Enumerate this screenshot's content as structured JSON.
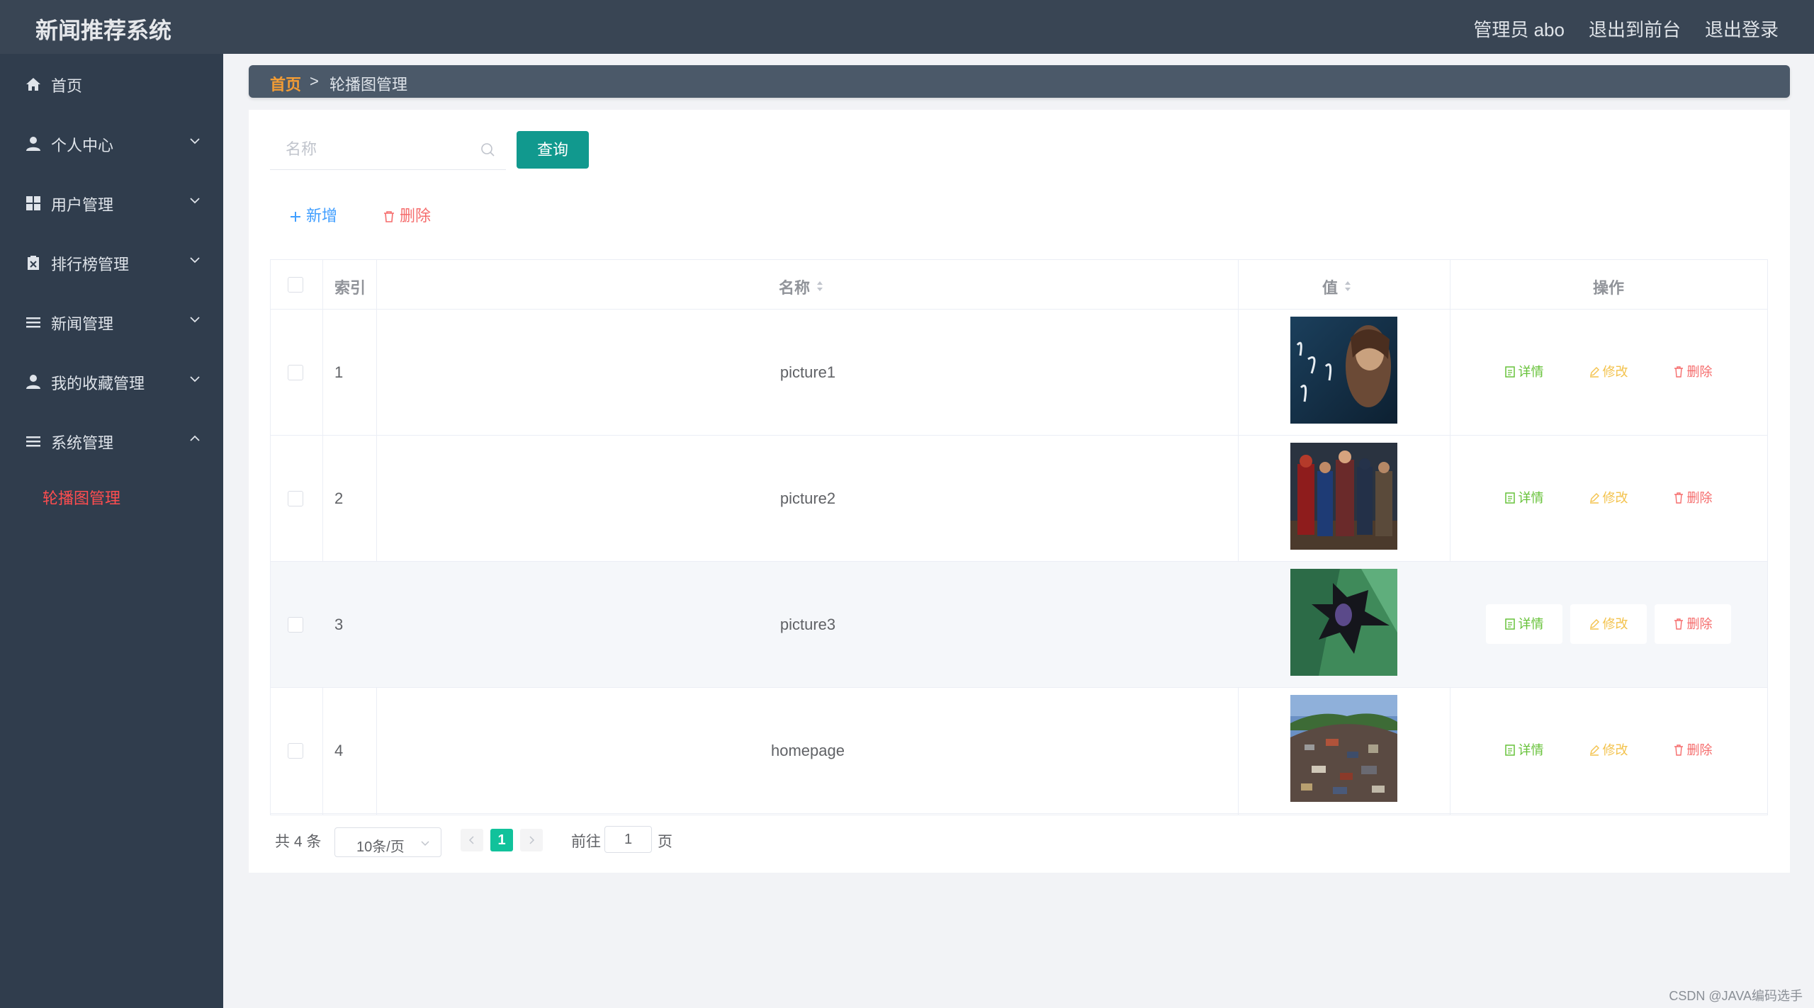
{
  "app": {
    "title": "新闻推荐系统",
    "top_links": [
      "管理员 abo",
      "退出到前台",
      "退出登录"
    ]
  },
  "sidebar": {
    "items": [
      {
        "label": "首页",
        "icon": "home-icon",
        "arrow": ""
      },
      {
        "label": "个人中心",
        "icon": "user-icon",
        "arrow": "chevron-down-icon"
      },
      {
        "label": "用户管理",
        "icon": "grid-icon",
        "arrow": "chevron-down-icon"
      },
      {
        "label": "排行榜管理",
        "icon": "clipboard-icon",
        "arrow": "chevron-down-icon"
      },
      {
        "label": "新闻管理",
        "icon": "list-icon",
        "arrow": "chevron-down-icon"
      },
      {
        "label": "我的收藏管理",
        "icon": "user-icon",
        "arrow": "chevron-down-icon"
      },
      {
        "label": "系统管理",
        "icon": "list-icon",
        "arrow": "chevron-up-icon"
      }
    ],
    "submenu": {
      "label": "轮播图管理"
    }
  },
  "breadcrumb": {
    "home": "首页",
    "separator": ">",
    "current": "轮播图管理"
  },
  "search": {
    "placeholder": "名称",
    "value": "",
    "button": "查询"
  },
  "actions": {
    "add": "新增",
    "delete": "删除"
  },
  "table": {
    "headers": {
      "index": "索引",
      "name": "名称",
      "value": "值",
      "ops": "操作"
    },
    "rows": [
      {
        "index": "1",
        "name": "picture1",
        "image": "poster-portrait-calligraphy"
      },
      {
        "index": "2",
        "name": "picture2",
        "image": "poster-superhero-team"
      },
      {
        "index": "3",
        "name": "picture3",
        "image": "poster-batman-abstract"
      },
      {
        "index": "4",
        "name": "homepage",
        "image": "photo-scrap-pile"
      }
    ],
    "row_actions": {
      "detail": "详情",
      "edit": "修改",
      "delete": "删除"
    }
  },
  "pagination": {
    "total": "共 4 条",
    "page_size": "10条/页",
    "current_page": "1",
    "goto_label": "前往",
    "goto_value": "1",
    "page_suffix": "页"
  },
  "watermark": "CSDN @JAVA编码选手",
  "colors": {
    "topbar": "#394554",
    "sidebar": "#303d4d",
    "accent": "#11998e",
    "active_menu": "#ff4d4f",
    "crumb_home": "#f39c34"
  }
}
